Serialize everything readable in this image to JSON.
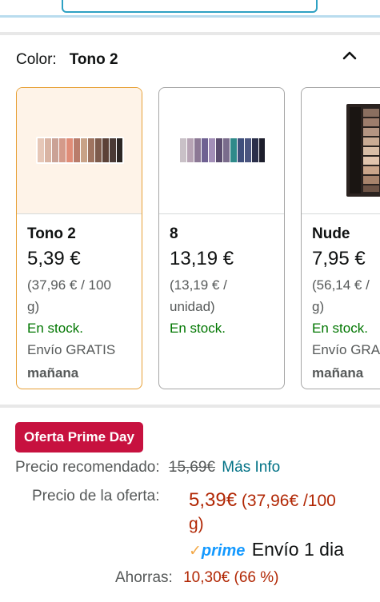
{
  "color_selector": {
    "label": "Color:",
    "selected": "Tono 2"
  },
  "variants": [
    {
      "name": "Tono 2",
      "price": "5,39 €",
      "unit_line1": "(37,96 € / 100",
      "unit_line2": "g)",
      "stock": "En stock.",
      "shipping": "Envío GRATIS",
      "shipping_day": "mañana",
      "selected": true
    },
    {
      "name": "8",
      "price": "13,19 €",
      "unit_line1": "(13,19 € /",
      "unit_line2": "unidad)",
      "stock": "En stock.",
      "shipping": "",
      "shipping_day": "",
      "selected": false
    },
    {
      "name": "Nude",
      "price": "7,95 €",
      "unit_line1": "(56,14 € /",
      "unit_line2": "g)",
      "stock": "En stock.",
      "shipping": "Envío GRA",
      "shipping_day": "mañana",
      "selected": false
    }
  ],
  "deal": {
    "badge": "Oferta Prime Day",
    "recommended_label": "Precio recomendado:",
    "recommended_price": "15,69€",
    "more_info": "Más Info",
    "offer_label": "Precio de la oferta:",
    "offer_price": "5,39€",
    "offer_unit_line1": "(37,96€ /100",
    "offer_unit_line2": "g)",
    "prime_check": "✓",
    "prime_word": "prime",
    "prime_shipping": "Envío 1 dia",
    "savings_label": "Ahorras:",
    "savings_value": "10,30€ (66 %)"
  },
  "colors": {
    "deal_red": "#c7113f",
    "price_red": "#b12704",
    "stock_green": "#007600",
    "link_teal": "#007185",
    "selected_border": "#e7a035",
    "prime_blue": "#1399ff"
  }
}
